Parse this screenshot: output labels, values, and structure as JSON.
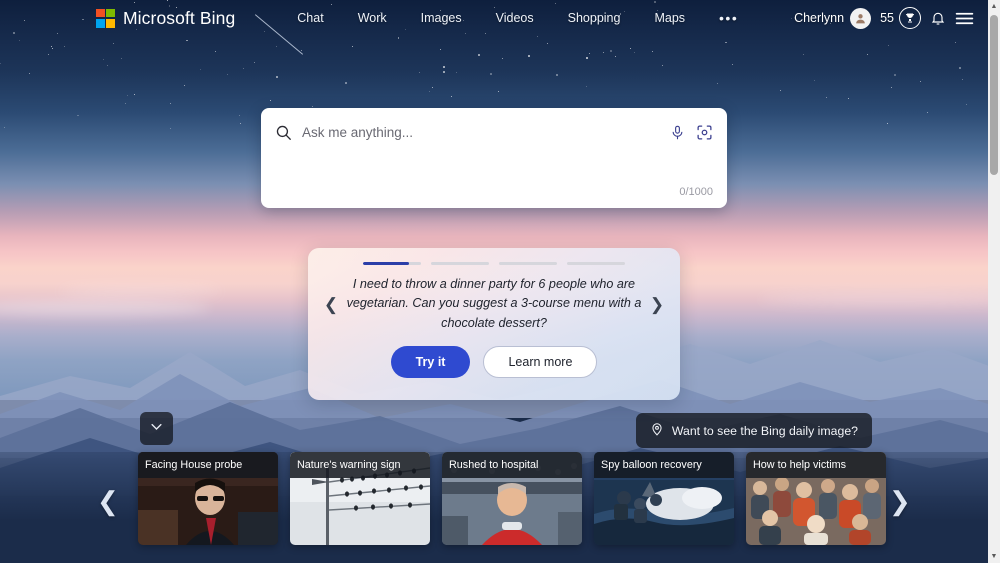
{
  "header": {
    "brand_name": "Microsoft Bing",
    "logo_icon": "microsoft-logo-icon",
    "logo_colors": [
      "#f25022",
      "#7fba00",
      "#00a4ef",
      "#ffb900"
    ],
    "nav_items": [
      {
        "label": "Chat"
      },
      {
        "label": "Work"
      },
      {
        "label": "Images"
      },
      {
        "label": "Videos"
      },
      {
        "label": "Shopping"
      },
      {
        "label": "Maps"
      }
    ],
    "more_label": "•••",
    "user_name": "Cherlynn",
    "avatar_icon": "user-avatar-icon",
    "rewards_points": "55",
    "rewards_icon": "trophy-icon",
    "notifications_icon": "bell-icon",
    "menu_icon": "hamburger-menu-icon"
  },
  "search": {
    "placeholder": "Ask me anything...",
    "value": "",
    "counter": "0/1000",
    "search_icon": "search-icon",
    "mic_icon": "microphone-icon",
    "camera_icon": "visual-search-camera-icon"
  },
  "suggestion": {
    "prompt": "I need to throw a dinner party for 6 people who are vegetarian. Can you suggest a 3-course menu with a chocolate dessert?",
    "try_label": "Try it",
    "learn_label": "Learn more",
    "prev_icon": "chevron-left-icon",
    "next_icon": "chevron-right-icon",
    "progress": [
      80,
      0,
      0,
      0
    ],
    "accent_color": "#2c3ea8",
    "primary_button_color": "#2f4ad0"
  },
  "daily_image_pill": {
    "label": "Want to see the Bing daily image?",
    "icon": "location-pin-icon"
  },
  "collapse_button": {
    "icon": "chevron-down-icon"
  },
  "news": {
    "prev_icon": "chevron-left-icon",
    "next_icon": "chevron-right-icon",
    "cards": [
      {
        "title": "Facing House probe",
        "image": "man-in-suit-at-hearing"
      },
      {
        "title": "Nature's warning sign",
        "image": "birds-on-power-lines"
      },
      {
        "title": "Rushed to hospital",
        "image": "man-in-red-shirt-stadium"
      },
      {
        "title": "Spy balloon recovery",
        "image": "sailors-recovering-balloon-at-sea"
      },
      {
        "title": "How to help victims",
        "image": "crowd-of-people-aid"
      }
    ]
  },
  "scrollbar": {
    "up_icon": "scroll-up-arrow-icon",
    "down_icon": "scroll-down-arrow-icon",
    "thumb": "scrollbar-thumb"
  }
}
